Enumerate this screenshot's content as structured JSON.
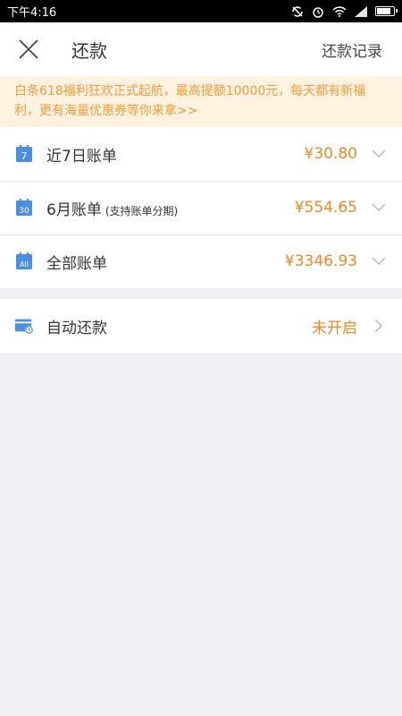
{
  "status_bar": {
    "time": "下午4:16"
  },
  "nav": {
    "title": "还款",
    "right_action": "还款记录"
  },
  "notice": {
    "text": "白条618福利狂欢正式起航，最高提额10000元，每天都有新福利，更有海量优惠券等你来拿>>"
  },
  "bills": [
    {
      "icon_text": "7",
      "label": "近7日账单",
      "sub": "",
      "amount": "¥30.80"
    },
    {
      "icon_text": "30",
      "label": "6月账单",
      "sub": "(支持账单分期)",
      "amount": "¥554.65"
    },
    {
      "icon_text": "All",
      "label": "全部账单",
      "sub": "",
      "amount": "¥3346.93"
    }
  ],
  "autopay": {
    "label": "自动还款",
    "status": "未开启"
  },
  "colors": {
    "accent": "#f5871f",
    "icon_blue": "#4a90e2",
    "notice_bg": "#fff3e0",
    "notice_text": "#f59a3a"
  }
}
